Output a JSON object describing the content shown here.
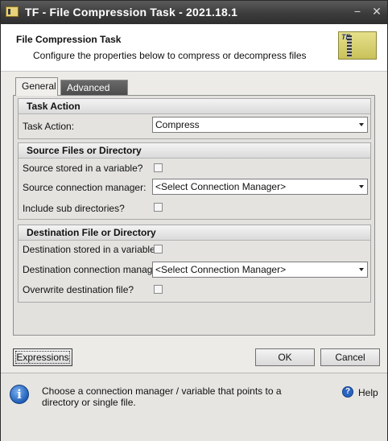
{
  "window": {
    "title": "TF - File Compression Task - 2021.18.1",
    "minimize_glyph": "−",
    "close_glyph": "✕"
  },
  "header": {
    "title": "File Compression Task",
    "subtitle": "Configure the properties below to compress or decompress files",
    "logo_text": "TF"
  },
  "tabs": [
    {
      "label": "General",
      "active": true
    },
    {
      "label": "Advanced",
      "active": false
    }
  ],
  "task_action": {
    "group_title": "Task Action",
    "label": "Task Action:",
    "value": "Compress"
  },
  "source": {
    "group_title": "Source Files or Directory",
    "stored_in_variable_label": "Source stored in a variable?",
    "stored_in_variable_checked": false,
    "connection_manager_label": "Source connection manager:",
    "connection_manager_value": "<Select Connection Manager>",
    "include_subdirs_label": "Include sub directories?",
    "include_subdirs_checked": false
  },
  "destination": {
    "group_title": "Destination File or Directory",
    "stored_in_variable_label": "Destination stored in a variable?",
    "stored_in_variable_checked": false,
    "connection_manager_label": "Destination connection manager:",
    "connection_manager_value": "<Select Connection Manager>",
    "overwrite_label": "Overwrite destination file?",
    "overwrite_checked": false
  },
  "buttons": {
    "expressions": "Expressions",
    "ok": "OK",
    "cancel": "Cancel"
  },
  "info": {
    "message": "Choose a connection manager / variable that points to a directory or single file.",
    "icon_glyph": "i",
    "help_glyph": "?",
    "help_label": "Help"
  }
}
